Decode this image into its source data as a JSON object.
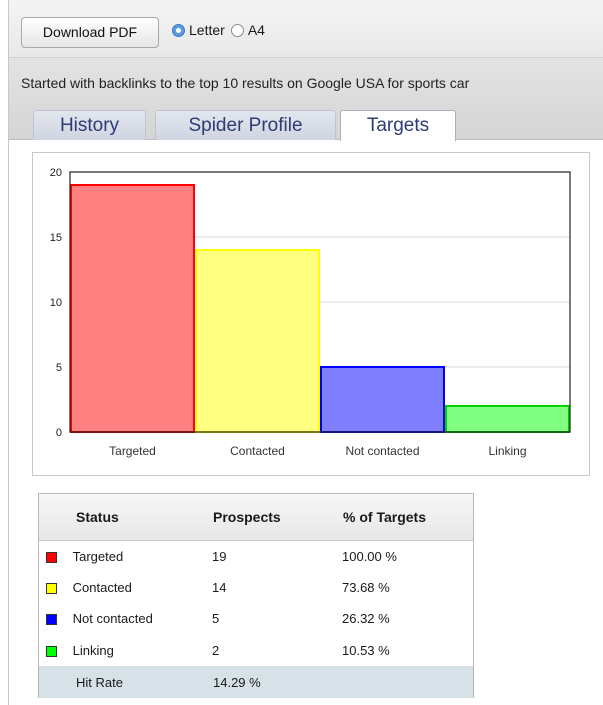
{
  "toolbar": {
    "download_label": "Download PDF",
    "paper_options": [
      {
        "label": "Letter",
        "selected": true
      },
      {
        "label": "A4",
        "selected": false
      }
    ]
  },
  "header": {
    "started_text": "Started with backlinks to the top 10 results on Google USA for sports car"
  },
  "tabs": [
    {
      "label": "History",
      "active": false
    },
    {
      "label": "Spider Profile",
      "active": false
    },
    {
      "label": "Targets",
      "active": true
    }
  ],
  "chart_data": {
    "type": "bar",
    "categories": [
      "Targeted",
      "Contacted",
      "Not contacted",
      "Linking"
    ],
    "values": [
      19,
      14,
      5,
      2
    ],
    "fill_colors": [
      "#ff8080",
      "#ffff80",
      "#8080ff",
      "#80ff80"
    ],
    "stroke_colors": [
      "#ff0000",
      "#ffff00",
      "#0000ff",
      "#00d000"
    ],
    "ylim": [
      0,
      20
    ],
    "yticks": [
      0,
      5,
      10,
      15,
      20
    ],
    "grid": true
  },
  "table": {
    "columns": [
      "Status",
      "Prospects",
      "% of Targets"
    ],
    "rows": [
      {
        "status": "Targeted",
        "prospects": "19",
        "percent": "100.00 %",
        "color": "#ff0000"
      },
      {
        "status": "Contacted",
        "prospects": "14",
        "percent": "73.68 %",
        "color": "#ffff00"
      },
      {
        "status": "Not contacted",
        "prospects": "5",
        "percent": "26.32 %",
        "color": "#0000ff"
      },
      {
        "status": "Linking",
        "prospects": "2",
        "percent": "10.53 %",
        "color": "#00ff00"
      }
    ],
    "footer": {
      "label": "Hit Rate",
      "value": "14.29 %"
    }
  }
}
